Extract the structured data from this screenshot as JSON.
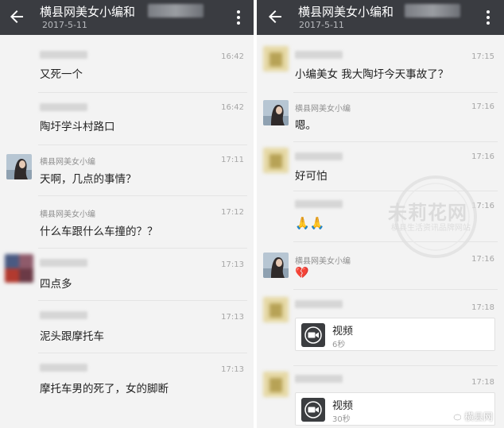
{
  "left": {
    "header": {
      "title": "横县网美女小编和",
      "date": "2017-5-11"
    },
    "messages": [
      {
        "time": "16:42",
        "text": "又死一个"
      },
      {
        "time": "16:42",
        "text": "陶圩学斗村路口"
      },
      {
        "sender": "横县网美女小编",
        "time": "17:11",
        "text": "天啊，几点的事情？"
      },
      {
        "sender": "横县网美女小编",
        "time": "17:12",
        "text": "什么车跟什么车撞的？？"
      },
      {
        "time": "17:13",
        "text": "四点多"
      },
      {
        "time": "17:13",
        "text": "泥头跟摩托车"
      },
      {
        "time": "17:13",
        "text": "摩托车男的死了，女的脚断"
      }
    ]
  },
  "right": {
    "header": {
      "title": "横县网美女小编和",
      "date": "2017-5-11"
    },
    "messages": [
      {
        "time": "17:15",
        "text": "小编美女 我大陶圩今天事故了？"
      },
      {
        "sender": "横县网美女小编",
        "time": "17:16",
        "text": "嗯。"
      },
      {
        "time": "17:16",
        "text": "好可怕"
      },
      {
        "time": "17:16",
        "text": "🙏🙏"
      },
      {
        "sender": "横县网美女小编",
        "time": "17:16",
        "text": "💔"
      },
      {
        "time": "17:18",
        "video_title": "视频",
        "video_duration": "6秒"
      },
      {
        "time": "17:18",
        "video_title": "视频",
        "video_duration": "30秒"
      }
    ]
  },
  "watermark": {
    "logo_text": "未莉花网",
    "sub_text": "横县生活资讯品牌网站"
  },
  "source_badge": "横县网",
  "colors": {
    "header_bg": "#3a3c41",
    "chat_bg": "#f3f3f3",
    "text": "#222222",
    "meta": "#a6a6a6"
  }
}
